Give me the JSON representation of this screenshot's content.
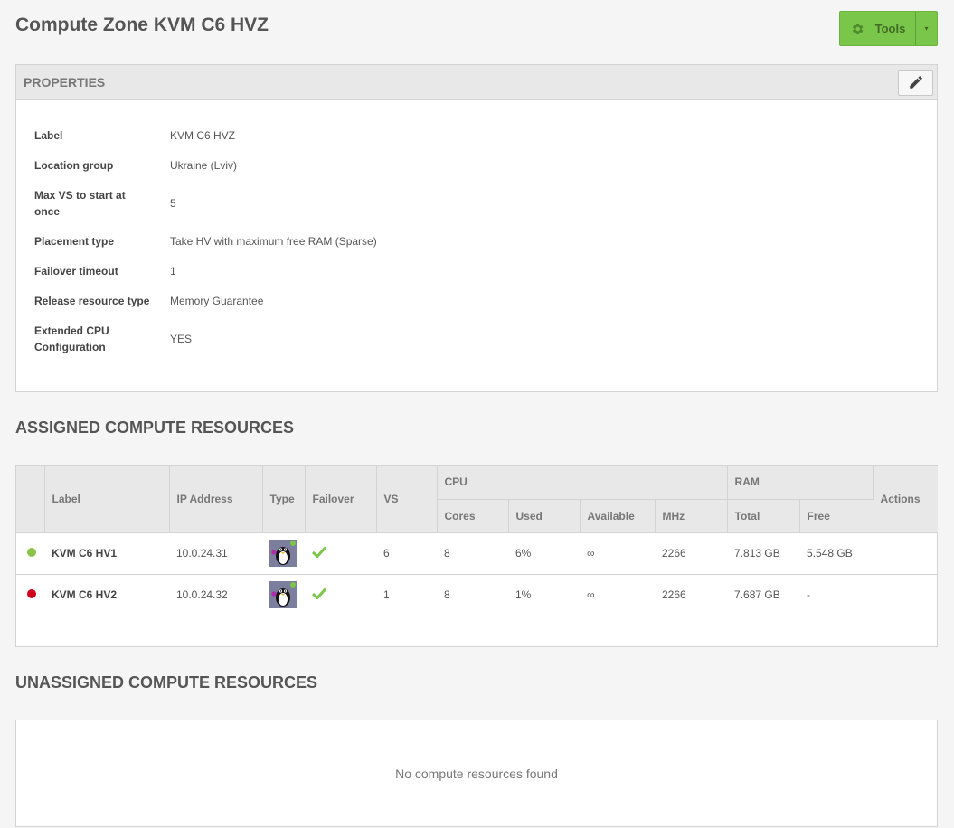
{
  "page": {
    "title": "Compute Zone KVM C6 HVZ"
  },
  "toolbar": {
    "tools_label": "Tools",
    "caret": "▾"
  },
  "properties": {
    "header": "PROPERTIES",
    "rows": [
      {
        "label": "Label",
        "value": "KVM C6 HVZ"
      },
      {
        "label": "Location group",
        "value": "Ukraine (Lviv)"
      },
      {
        "label": "Max VS to start at once",
        "value": "5"
      },
      {
        "label": "Placement type",
        "value": "Take HV with maximum free RAM (Sparse)"
      },
      {
        "label": "Failover timeout",
        "value": "1"
      },
      {
        "label": "Release resource type",
        "value": "Memory Guarantee"
      },
      {
        "label": "Extended CPU Configuration",
        "value": "YES"
      }
    ]
  },
  "assigned": {
    "title": "ASSIGNED COMPUTE RESOURCES",
    "headers": {
      "label": "Label",
      "ip": "IP Address",
      "type": "Type",
      "failover": "Failover",
      "vs": "VS",
      "cpu": "CPU",
      "cores": "Cores",
      "used": "Used",
      "available": "Available",
      "mhz": "MHz",
      "ram": "RAM",
      "total": "Total",
      "free": "Free",
      "actions": "Actions"
    },
    "rows": [
      {
        "status_color": "#8bc34a",
        "label": "KVM C6 HV1",
        "ip": "10.0.24.31",
        "vs": "6",
        "cores": "8",
        "used": "6%",
        "available": "∞",
        "mhz": "2266",
        "total": "7.813 GB",
        "free": "5.548 GB"
      },
      {
        "status_color": "#d0021b",
        "label": "KVM C6 HV2",
        "ip": "10.0.24.32",
        "vs": "1",
        "cores": "8",
        "used": "1%",
        "available": "∞",
        "mhz": "2266",
        "total": "7.687 GB",
        "free": "-"
      }
    ]
  },
  "unassigned": {
    "title": "UNASSIGNED COMPUTE RESOURCES",
    "empty_message": "No compute resources found"
  },
  "colors": {
    "accent_green": "#7ac64a",
    "check_green": "#7ac64a"
  },
  "icons": {
    "tools": "gear-icon",
    "edit": "pencil-icon",
    "type": "linux-tux-icon",
    "failover": "checkmark-icon"
  }
}
